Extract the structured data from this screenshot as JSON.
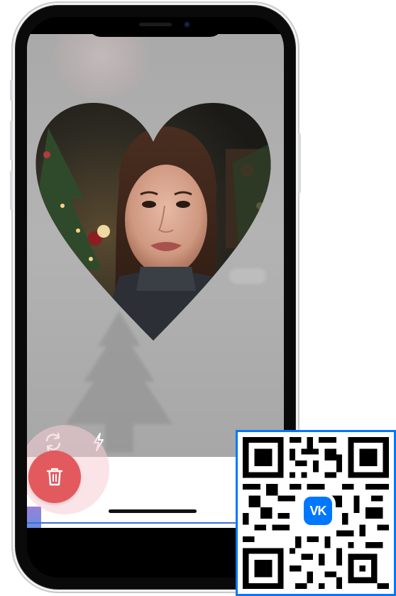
{
  "app": {
    "screen": "camera-recorder",
    "overlay_shape": "heart"
  },
  "controls": {
    "flip_icon": "rotate-camera-icon",
    "flash_icon": "lightning-icon",
    "delete_icon": "trash-icon"
  },
  "qr": {
    "logo_label": "VK",
    "logo_color": "#0077ff",
    "border_color": "#0077ff"
  },
  "colors": {
    "delete_button": "#e25a5e",
    "delete_halo": "#f5cdd4",
    "camera_background": "#ababab"
  }
}
